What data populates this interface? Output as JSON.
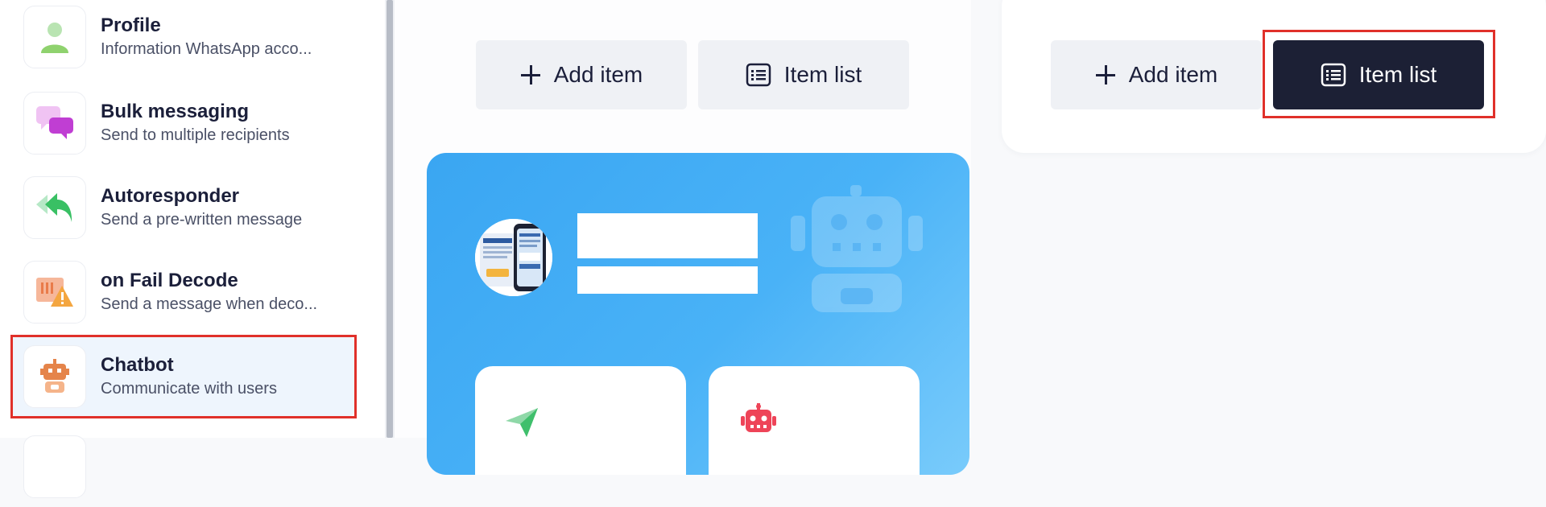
{
  "sidebar": {
    "items": [
      {
        "title": "Profile",
        "subtitle": "Information WhatsApp acco...",
        "icon": "profile-icon"
      },
      {
        "title": "Bulk messaging",
        "subtitle": "Send to multiple recipients",
        "icon": "chat-bubbles-icon"
      },
      {
        "title": "Autoresponder",
        "subtitle": "Send a pre-written message",
        "icon": "reply-arrow-icon"
      },
      {
        "title": "on Fail Decode",
        "subtitle": "Send a message when deco...",
        "icon": "warning-icon"
      },
      {
        "title": "Chatbot",
        "subtitle": "Communicate with users",
        "icon": "robot-icon",
        "active": true
      }
    ]
  },
  "toolbar_center": {
    "add_label": "Add item",
    "list_label": "Item list"
  },
  "toolbar_right": {
    "add_label": "Add item",
    "list_label": "Item list",
    "list_active": true
  },
  "colors": {
    "accent_dark": "#1c2035",
    "highlight_red": "#e0302a",
    "card_blue": "#3aa6f2",
    "active_bg": "#eef5fd"
  }
}
